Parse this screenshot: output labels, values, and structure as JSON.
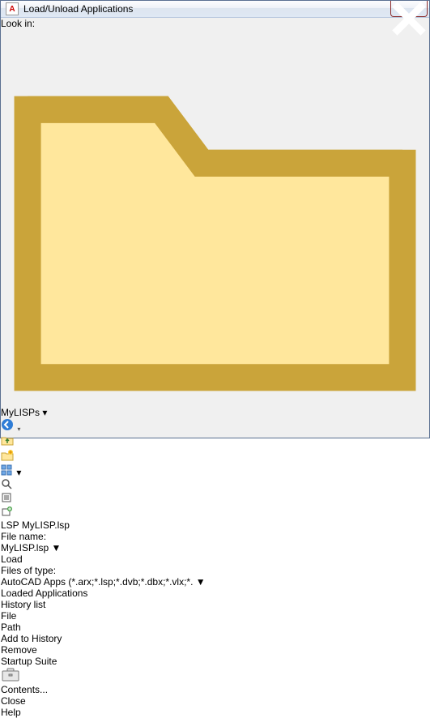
{
  "window": {
    "title": "Load/Unload Applications",
    "app_icon_label": "A"
  },
  "lookin": {
    "label": "Look in:",
    "value": "MyLISPs"
  },
  "toolbar": {
    "back_icon": "back-icon",
    "up_icon": "up-folder-icon",
    "new_icon": "new-folder-icon",
    "views_icon": "views-icon",
    "search_icon": "search-icon",
    "filter_icon": "funnel-icon",
    "add_icon": "add-location-icon"
  },
  "files": [
    {
      "icon_label": "LSP",
      "name": "MyLISP.lsp",
      "selected": true
    }
  ],
  "filename": {
    "label": "File name:",
    "value": "MyLISP.lsp"
  },
  "filetype": {
    "label": "Files of type:",
    "value": "AutoCAD Apps (*.arx;*.lsp;*.dvb;*.dbx;*.vlx;*."
  },
  "buttons": {
    "load": "Load",
    "remove": "Remove",
    "contents": "Contents...",
    "close": "Close",
    "help": "Help"
  },
  "tabs": {
    "loaded": "Loaded Applications",
    "history": "History list",
    "active": "history"
  },
  "history": {
    "col_file": "File",
    "col_path": "Path"
  },
  "right_panel": {
    "add_history": "Add to History",
    "startup_suite": "Startup Suite"
  }
}
